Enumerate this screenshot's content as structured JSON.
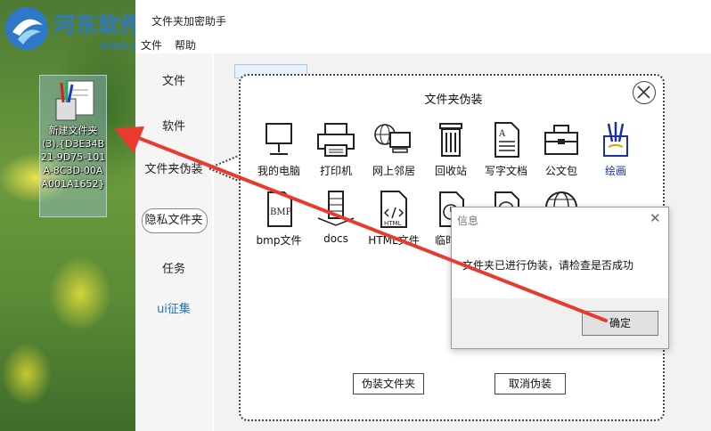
{
  "watermark": {
    "title": "河东软件园",
    "url": "www.pc0359.cn"
  },
  "desktop_icon": {
    "label": "新建文件夹(3).{D3E34B21-9D75-101A-8C3D-00AA001A1652}"
  },
  "window": {
    "title": "文件夹加密助手",
    "menu": {
      "file": "文件",
      "help": "帮助"
    },
    "sidebar": [
      "文件",
      "软件",
      "文件夹伪装",
      "隐私文件夹",
      "任务",
      "ui征集"
    ]
  },
  "popup": {
    "title": "文件夹伪装",
    "items": [
      {
        "label": "我的电脑",
        "icon": "computer-icon"
      },
      {
        "label": "打印机",
        "icon": "printer-icon"
      },
      {
        "label": "网上邻居",
        "icon": "network-icon"
      },
      {
        "label": "回收站",
        "icon": "recycle-bin-icon"
      },
      {
        "label": "写字文档",
        "icon": "document-icon"
      },
      {
        "label": "公文包",
        "icon": "briefcase-icon"
      },
      {
        "label": "绘画",
        "icon": "paint-icon"
      },
      {
        "label": "bmp文件",
        "icon": "bmp-file-icon"
      },
      {
        "label": "docs",
        "icon": "docs-icon"
      },
      {
        "label": "HTML文件",
        "icon": "html-file-icon"
      },
      {
        "label": "临时文",
        "icon": "clock-icon"
      },
      {
        "label": "",
        "icon": "disc-icon"
      },
      {
        "label": "",
        "icon": "globe-icon"
      }
    ],
    "disguise_button": "伪装文件夹",
    "cancel_button": "取消伪装"
  },
  "dialog": {
    "title": "信息",
    "message": "文件夹已进行伪装，请检查是否成功",
    "ok_button": "确定"
  },
  "colors": {
    "accent": "#1a73c6",
    "arrow": "#e83b2e",
    "watermark": "#2d79c7"
  }
}
